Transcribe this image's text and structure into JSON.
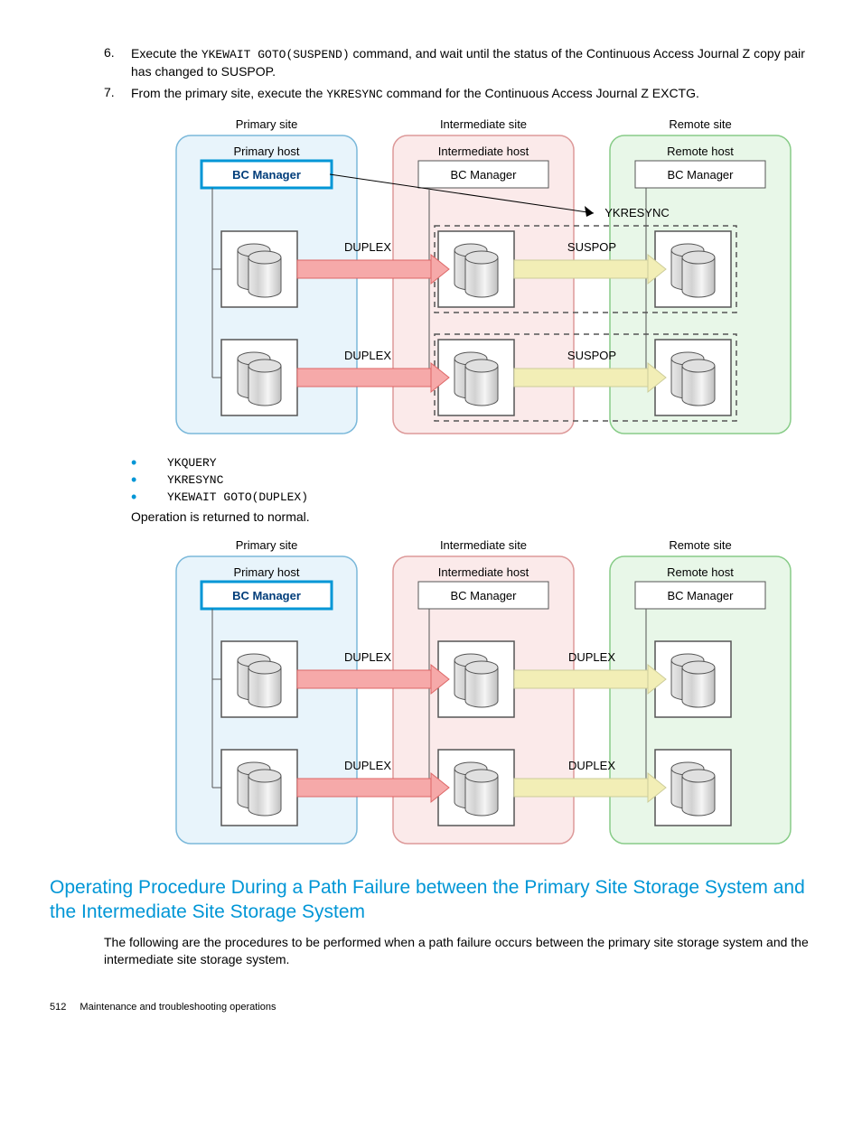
{
  "items": [
    {
      "num": "6.",
      "pre": "Execute the ",
      "code": "YKEWAIT GOTO(SUSPEND)",
      "post": " command, and wait until the status of the Continuous Access Journal Z copy pair has changed to SUSPOP."
    },
    {
      "num": "7.",
      "pre": "From the primary site, execute the ",
      "code": "YKRESYNC",
      "post": " command for the Continuous Access Journal Z EXCTG."
    }
  ],
  "diagram1": {
    "sites": {
      "primary": {
        "site": "Primary site",
        "host": "Primary host",
        "bc": "BC Manager"
      },
      "intermediate": {
        "site": "Intermediate site",
        "host": "Intermediate host",
        "bc": "BC Manager"
      },
      "remote": {
        "site": "Remote site",
        "host": "Remote host",
        "bc": "BC Manager"
      }
    },
    "cmd": "YKRESYNC",
    "statuses": [
      "DUPLEX",
      "DUPLEX",
      "SUSPOP",
      "SUSPOP"
    ]
  },
  "bullets": [
    "YKQUERY",
    "YKRESYNC",
    "YKEWAIT GOTO(DUPLEX)"
  ],
  "opReturn": "Operation is returned to normal.",
  "diagram2": {
    "sites": {
      "primary": {
        "site": "Primary site",
        "host": "Primary host",
        "bc": "BC Manager"
      },
      "intermediate": {
        "site": "Intermediate site",
        "host": "Intermediate host",
        "bc": "BC Manager"
      },
      "remote": {
        "site": "Remote site",
        "host": "Remote host",
        "bc": "BC Manager"
      }
    },
    "statuses": [
      "DUPLEX",
      "DUPLEX",
      "DUPLEX",
      "DUPLEX"
    ]
  },
  "sectionHead": "Operating Procedure During a Path Failure between the Primary Site Storage System and the Intermediate Site Storage System",
  "introText": "The following are the procedures to be performed when a path failure occurs between the primary site storage system and the intermediate site storage system.",
  "footer": {
    "page": "512",
    "title": "Maintenance and troubleshooting operations"
  }
}
